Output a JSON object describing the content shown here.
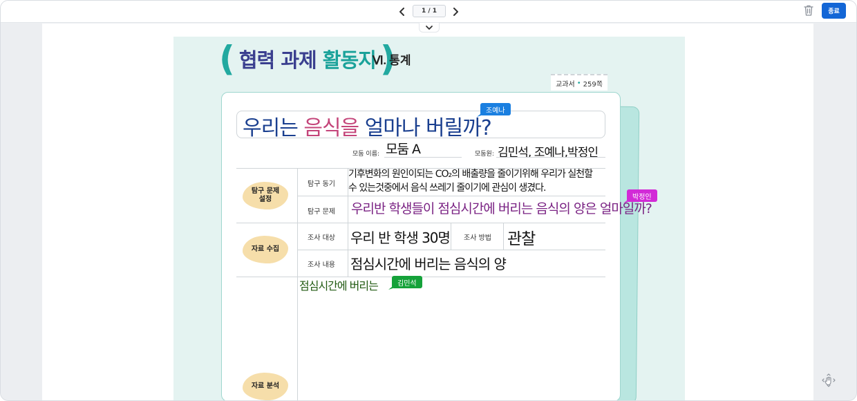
{
  "toolbar": {
    "page_indicator": "1 / 1",
    "end_label": "종료"
  },
  "worksheet": {
    "title_open": "(",
    "title_part1": "협력 과제",
    "title_part2": "활동지",
    "title_close": ")",
    "chapter": "Ⅵ. 통계",
    "page_ref_label": "교과서",
    "page_ref_dot": "•",
    "page_ref_page": "259쪽",
    "question_part1": "우리는 ",
    "question_part2": "음식을",
    "question_part3": " 얼마나 버릴까?",
    "group_name_label": "모둠 이름:",
    "group_name_value": "모둠 A",
    "members_label": "모둠원:",
    "members_value": "김민석, 조예나,박정인",
    "sections": {
      "problem_setting": "탐구 문제\n설정",
      "data_collection": "자료 수집",
      "data_analysis": "자료 분석"
    },
    "rows": {
      "motivation_label": "탐구 동기",
      "motivation_line1": "기후변화의 원인이되는 CO₂의 배출량을 줄이기위해 우리가 실천할",
      "motivation_line2": "수 있는것중에서 음식 쓰레기 줄이기에 관심이 생겼다.",
      "problem_label": "탐구 문제",
      "problem_value": "우리반 학생들이 점심시간에 버리는 음식의 양은 얼마일까?",
      "target_label": "조사 대상",
      "target_value": "우리 반 학생 30명",
      "method_label": "조사 방법",
      "method_value": "관찰",
      "content_label": "조사 내용",
      "content_value": "점심시간에 버리는 음식의 양",
      "analysis_value": "점심시간에 버리는"
    }
  },
  "cursors": {
    "joyena": "조예나",
    "parkjeongin": "박정인",
    "kimminseok": "김민석"
  },
  "colors": {
    "accent_blue": "#1366d6",
    "title_teal": "#22a9a0",
    "title_navy": "#3a3f8f",
    "tag_blue": "#1a7fe0",
    "tag_pink": "#d22ad7",
    "tag_green": "#15a23a",
    "section_blob": "#f6deaa"
  },
  "icons": {
    "prev": "chevron-left-icon",
    "next": "chevron-right-icon",
    "collapse": "chevron-down-icon",
    "trash": "trash-icon",
    "move": "move-hand-icon"
  }
}
